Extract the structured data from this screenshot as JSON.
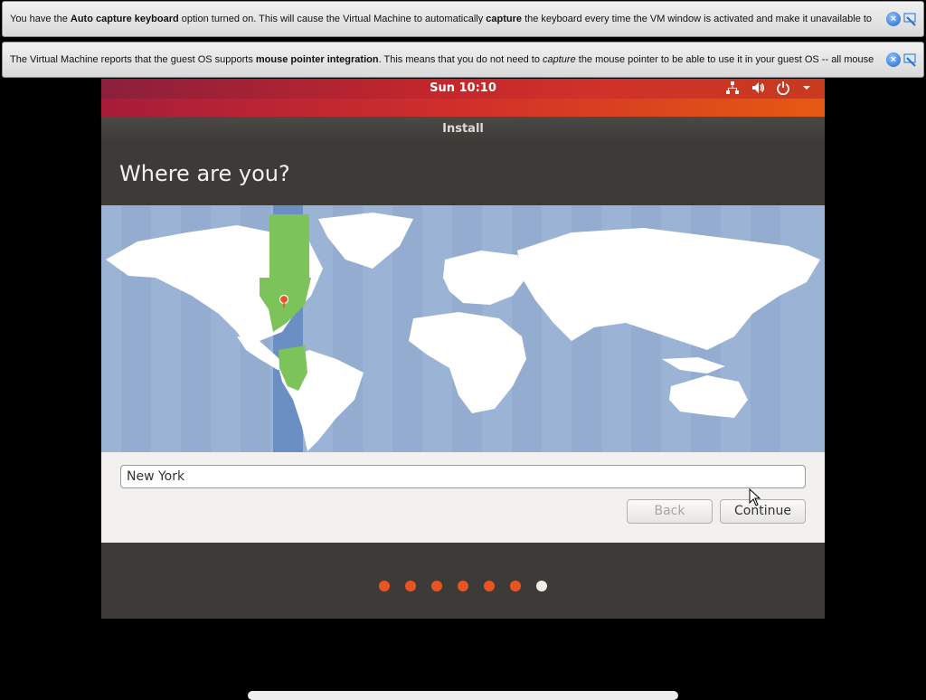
{
  "vbox": {
    "bar1": {
      "pre": "You have the ",
      "b1": "Auto capture keyboard",
      "mid": " option turned on. This will cause the Virtual Machine to automatically ",
      "b2": "capture",
      "post": " the keyboard every time the VM window is activated and make it unavailable to"
    },
    "bar2": {
      "pre": "The Virtual Machine reports that the guest OS supports ",
      "b1": "mouse pointer integration",
      "mid": ". This means that you do not need to ",
      "i1": "capture",
      "post": " the mouse pointer to be able to use it in your guest OS -- all mouse"
    }
  },
  "topbar": {
    "clock": "Sun 10:10"
  },
  "window": {
    "title": "Install",
    "heading": "Where are you?",
    "location_value": "New York",
    "back_label": "Back",
    "continue_label": "Continue"
  },
  "progress": {
    "total_steps": 7,
    "current_step": 7
  },
  "colors": {
    "accent": "#e95420",
    "map_ocean": "#9bb4d6",
    "timezone_highlight": "#7cc45a"
  }
}
